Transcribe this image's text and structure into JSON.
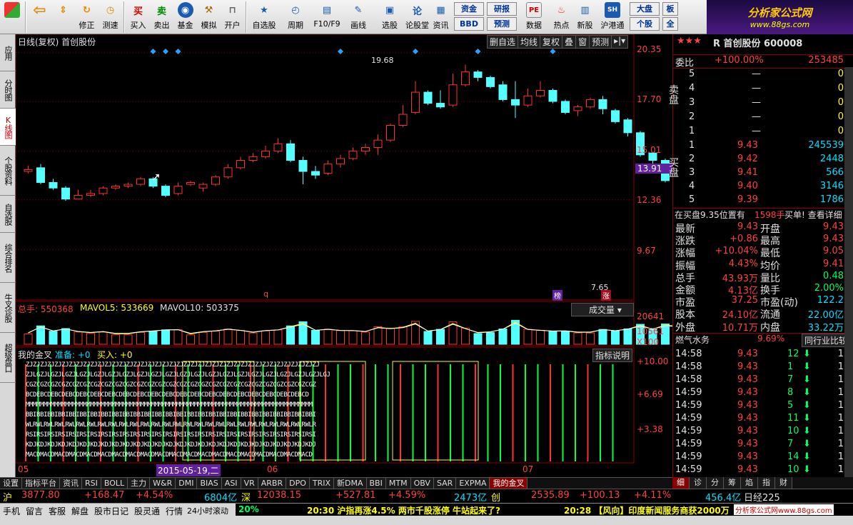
{
  "toolbar": {
    "buttons": [
      "修正",
      "测速",
      "买入",
      "卖出",
      "基金",
      "模拟",
      "开户",
      "自选股",
      "周期",
      "F10/F9",
      "画线",
      "选股",
      "论股堂",
      "资讯",
      "数据",
      "热点",
      "新股",
      "沪港通"
    ],
    "boxes": [
      "资金",
      "BBD",
      "研报",
      "预测",
      "大盘",
      "个股",
      "板",
      "全"
    ]
  },
  "logo": {
    "line1": "分析家公式网",
    "line2": "www.88gs.com"
  },
  "vtabs": [
    "应用",
    "分时图",
    "K线图",
    "个股资料",
    "自选股",
    "综合排名",
    "牛叉诊股",
    "超级盘口"
  ],
  "chart": {
    "title": "日线(复权)  首创股份",
    "menu": [
      "删自选",
      "均线",
      "复权",
      "叠",
      "窗",
      "预测"
    ],
    "price_ticks": [
      "20.35",
      "17.70",
      "15.01",
      "12.36",
      "9.67"
    ],
    "current_price": "13.91",
    "hi_label": "19.68",
    "lo_label": "7.65",
    "vol_label": "成交量",
    "vol_info": {
      "total": "总手: 550368",
      "ma5": "MAVOL5: 533669",
      "ma10": "MAVOL10: 503375"
    },
    "vol_ticks": [
      "20641",
      "10561",
      "X100"
    ],
    "ind_info": {
      "name": "我的金叉",
      "ready": "准备: +0",
      "buy": "买入: +0"
    },
    "ind_btn": "指标说明",
    "ind_ticks": [
      "+10.00",
      "+6.69",
      "+3.38"
    ],
    "dates": [
      "05",
      "2015-05-19,二",
      "06",
      "07"
    ],
    "ind_rows": [
      "ZJZJZJZJZJZJZJZJZJZJZJZJZJZJZJZJZJZJZJZJZJZJZJZJZJZJZJZJZJZJZJZJZJZJZJZJZJZJZJZJZJ",
      "ZJLGZJLGZJLGZJLGZJLGZJLGZJLGZJLGZJLGZJLGZJLGZJLGZJLGZJLGZJLGZJLGZJLGZJLGZJLGZJLGZJLGJ",
      "CGZCGZCGZCGZCGZCGZCGZCGZCGZCGZCGZCGZCGZCGZCGZCGZCGZCGZCGZCGZCGZCGZCGZCGZCGZCGZCGZ",
      "BCDEBCDEBCDEBCDEBCDEBCDEBCDEBCDEBCDEBCDEBCDEBCDEBCDEBCDEBCDEBCDEBCDEBCDEBCDEBCD",
      "MMMMMMMMMMMMMMMMMMMMMMMMMMMMMMMMMMMMMMMMMMMMMMMMMMMMMMMMMMMMMMMMMMMMMMMMMMMMMMMM",
      "BBIBBIBBIBBIBBIBBIBBIBBIBBIBBIBBIBBIBBIBBIBBIBBIBBIBBIBBIBBIBBIBBIBBIBBIBBIBBIBBI",
      "WLRWLRWLRWLRWLRWLRWLRWLRWLRWLRWLRWLRWLRWLRWLRWLRWLRWLRWLRWLRWLRWLRWLRWLRWLRWLRWLR",
      "RSIRSIRSIRSIRSIRSIRSIRSIRSIRSIRSIRSIRSIRSIRSIRSIRSIRSIRSIRSIRSIRSIRSIRSIRSIRSIRSI",
      "KDJKDJKDJKDJKDJKDJKDJKDJKDJKDJKDJKDJKDJKDJKDJKDJKDJKDJKDJKDJKDJKDJKDJKDJKDJKDJKDJ",
      "MACDMACDMACDMACDMACDMACDMACDMACDMACDMACDMACDMACDMACDMACDMACDMACDMACDMACDMACDMACD"
    ],
    "mark_q": "q",
    "mark_bang": "榜",
    "mark_zhang": "涨"
  },
  "chart_data": {
    "type": "candlestick",
    "series": [
      {
        "name": "K线",
        "values": [
          [
            13.9,
            14.0,
            14.2,
            13.8
          ],
          [
            14.1,
            13.3,
            14.3,
            13.2
          ],
          [
            13.3,
            13.0,
            13.5,
            12.9
          ],
          [
            13.0,
            12.4,
            13.1,
            12.3
          ],
          [
            12.4,
            12.6,
            12.9,
            12.4
          ],
          [
            12.6,
            12.7,
            12.9,
            12.5
          ],
          [
            12.7,
            13.0,
            13.1,
            12.6
          ],
          [
            13.0,
            13.1,
            13.2,
            12.9
          ],
          [
            13.1,
            13.2,
            13.3,
            13.0
          ],
          [
            13.2,
            13.5,
            13.6,
            13.1
          ],
          [
            13.5,
            13.1,
            13.6,
            13.0
          ],
          [
            13.1,
            12.6,
            13.2,
            12.5
          ],
          [
            12.7,
            13.1,
            13.3,
            12.6
          ],
          [
            13.2,
            13.3,
            13.4,
            13.1
          ],
          [
            13.0,
            13.2,
            13.3,
            12.8
          ],
          [
            13.2,
            13.6,
            13.7,
            13.1
          ],
          [
            13.6,
            14.1,
            14.3,
            13.5
          ],
          [
            14.1,
            14.5,
            14.7,
            14.0
          ],
          [
            14.5,
            14.7,
            14.9,
            14.4
          ],
          [
            14.7,
            15.0,
            15.3,
            14.6
          ],
          [
            15.0,
            15.4,
            15.7,
            14.9
          ],
          [
            15.4,
            14.5,
            15.6,
            14.4
          ],
          [
            14.5,
            13.9,
            14.7,
            13.2
          ],
          [
            13.9,
            13.7,
            14.2,
            13.5
          ],
          [
            13.8,
            14.3,
            14.5,
            13.7
          ],
          [
            14.3,
            14.6,
            14.8,
            14.1
          ],
          [
            14.6,
            15.0,
            15.2,
            14.5
          ],
          [
            15.0,
            15.2,
            15.4,
            14.8
          ],
          [
            15.2,
            15.6,
            15.9,
            14.8
          ],
          [
            15.6,
            16.4,
            16.5,
            15.5
          ],
          [
            16.4,
            17.0,
            17.5,
            16.3
          ],
          [
            17.1,
            18.2,
            18.8,
            17.0
          ],
          [
            18.2,
            17.6,
            18.3,
            17.5
          ],
          [
            17.6,
            17.4,
            18.3,
            17.3
          ],
          [
            17.5,
            18.6,
            19.2,
            17.4
          ],
          [
            18.6,
            19.3,
            19.7,
            18.5
          ],
          [
            19.3,
            19.0,
            19.4,
            18.8
          ],
          [
            19.0,
            18.5,
            19.1,
            18.4
          ],
          [
            18.6,
            17.8,
            18.8,
            17.7
          ],
          [
            17.8,
            17.5,
            18.8,
            16.8
          ],
          [
            17.5,
            18.0,
            18.4,
            17.4
          ],
          [
            18.0,
            18.3,
            18.8,
            17.9
          ],
          [
            18.3,
            17.7,
            18.4,
            17.6
          ],
          [
            17.7,
            17.1,
            17.8,
            17.0
          ],
          [
            17.2,
            17.4,
            17.5,
            16.9
          ],
          [
            17.4,
            17.8,
            17.9,
            17.3
          ],
          [
            17.8,
            17.3,
            18.0,
            17.0
          ],
          [
            17.2,
            16.6,
            17.3,
            16.5
          ],
          [
            16.7,
            16.0,
            16.8,
            15.8
          ],
          [
            16.0,
            14.8,
            16.1,
            14.7
          ],
          [
            14.9,
            14.5,
            14.9,
            14.0
          ],
          [
            14.5,
            13.4,
            14.6,
            13.3
          ],
          [
            13.4,
            12.6,
            13.6,
            12.5
          ],
          [
            12.6,
            11.4,
            12.7,
            11.3
          ],
          [
            11.4,
            10.3,
            11.5,
            10.2
          ],
          [
            10.4,
            9.4,
            10.5,
            9.3
          ],
          [
            9.4,
            8.3,
            9.5,
            8.2
          ],
          [
            8.2,
            8.6,
            8.8,
            7.65
          ],
          [
            8.5,
            8.1,
            8.6,
            7.9
          ],
          [
            8.6,
            9.43,
            9.43,
            8.5
          ]
        ]
      }
    ]
  },
  "quote": {
    "stars": "★★★",
    "stock": "R 首创股份 600008",
    "wb_label": "委比",
    "wb_val": "+100.00%",
    "wb_num": "253485",
    "sell_label": "卖盘",
    "buy_label": "买盘",
    "sells": [
      [
        "5",
        "—",
        "0"
      ],
      [
        "4",
        "—",
        "0"
      ],
      [
        "3",
        "—",
        "0"
      ],
      [
        "2",
        "—",
        "0"
      ],
      [
        "1",
        "—",
        "0"
      ]
    ],
    "buys": [
      [
        "1",
        "9.43",
        "245539"
      ],
      [
        "2",
        "9.42",
        "2448"
      ],
      [
        "3",
        "9.41",
        "566"
      ],
      [
        "4",
        "9.40",
        "3146"
      ],
      [
        "5",
        "9.39",
        "1786"
      ]
    ],
    "note": "在买盘9.35位置有",
    "note_num": "1598手",
    "note2": "买单! 查看详细",
    "stats": [
      [
        "最新",
        "9.43",
        "开盘",
        "9.43"
      ],
      [
        "涨跌",
        "+0.86",
        "最高",
        "9.43"
      ],
      [
        "涨幅",
        "+10.04%",
        "最低",
        "9.05"
      ],
      [
        "振幅",
        "4.43%",
        "均价",
        "9.41"
      ],
      [
        "总手",
        "43.93万",
        "量比",
        "0.48"
      ],
      [
        "金额",
        "4.13亿",
        "换手",
        "2.00%"
      ],
      [
        "市盈",
        "37.25",
        "市盈(动)",
        "122.2"
      ],
      [
        "股本",
        "24.10亿",
        "流通",
        "22.00亿"
      ],
      [
        "外盘",
        "10.71万",
        "内盘",
        "33.22万"
      ]
    ],
    "industry": "燃气水务",
    "industry_pct": "9.69%",
    "compare_btn": "同行业比较",
    "ticks": [
      [
        "14:58",
        "9.43",
        "12",
        "1"
      ],
      [
        "14:58",
        "9.43",
        "1",
        "1"
      ],
      [
        "14:58",
        "9.43",
        "7",
        "1"
      ],
      [
        "14:59",
        "9.43",
        "8",
        "1"
      ],
      [
        "14:59",
        "9.43",
        "5",
        "1"
      ],
      [
        "14:59",
        "9.43",
        "11",
        "1"
      ],
      [
        "14:59",
        "9.43",
        "10",
        "1"
      ],
      [
        "14:59",
        "9.43",
        "7",
        "1"
      ],
      [
        "14:59",
        "9.43",
        "14",
        "1"
      ],
      [
        "14:59",
        "9.43",
        "10",
        "1"
      ]
    ]
  },
  "bottom_tabs": [
    "设置",
    "指标平台",
    "资讯",
    "RSI",
    "BOLL",
    "主力",
    "W&R",
    "DMI",
    "BIAS",
    "ASI",
    "VR",
    "ARBR",
    "DPO",
    "TRIX",
    "新DMA",
    "BBI",
    "MTM",
    "OBV",
    "SAR",
    "EXPMA",
    "我的金叉"
  ],
  "right_tabs": [
    "细",
    "诊",
    "分",
    "筹",
    "焰",
    "指",
    "财"
  ],
  "index": {
    "sh": "沪",
    "sh_v": "3877.80",
    "sh_c": "+168.47",
    "sh_p": "+4.54%",
    "sh_a": "6804亿",
    "sz": "深",
    "sz_v": "12038.15",
    "sz_c": "+527.81",
    "sz_p": "+4.59%",
    "sz_a": "2473亿",
    "cy": "创",
    "cy_v": "2535.89",
    "cy_c": "+100.13",
    "cy_p": "+4.11%",
    "cy_a": "456.4亿",
    "nk": "日经225"
  },
  "statusbar": {
    "items": [
      "手机",
      "留言",
      "客服",
      "解盘",
      "股市日记",
      "股灵通",
      "行情",
      "24小时滚动"
    ],
    "pct": "20%",
    "news1": "20:30 沪指再涨4.5% 两市千股涨停 牛站起来了?",
    "news2": "20:28 【风向】印度新闻服务商获2000万",
    "site": "分析家公式网www.88gs.com"
  }
}
